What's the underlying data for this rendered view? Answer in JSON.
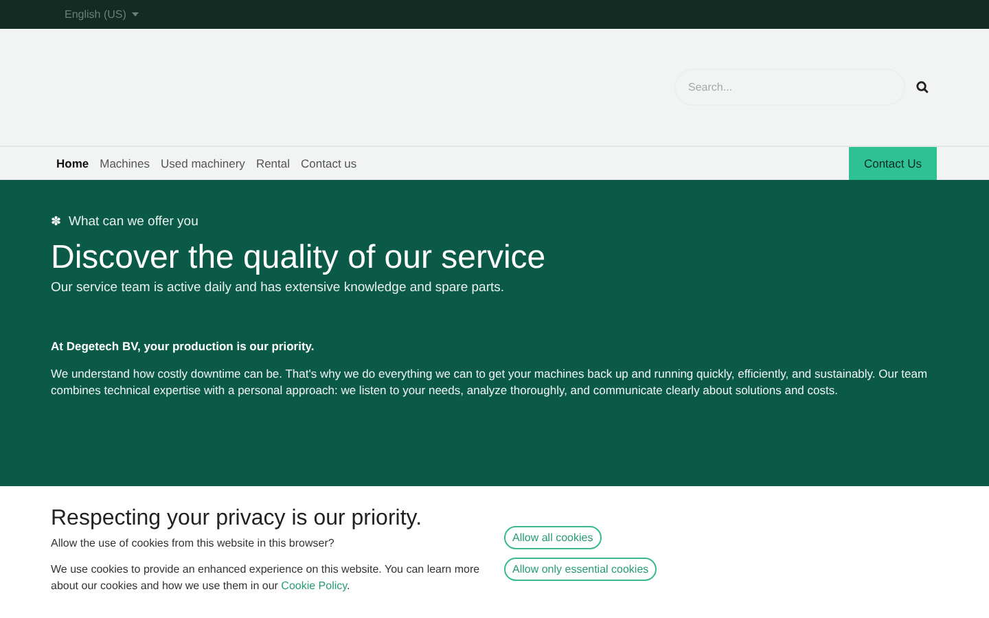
{
  "top_bar": {
    "language": "English (US)"
  },
  "header": {
    "search": {
      "placeholder": "Search..."
    }
  },
  "nav": {
    "items": [
      {
        "label": "Home",
        "selected": true
      },
      {
        "label": "Machines",
        "selected": false
      },
      {
        "label": "Used machinery",
        "selected": false
      },
      {
        "label": "Rental",
        "selected": false
      },
      {
        "label": "Contact us",
        "selected": false
      }
    ],
    "cta": "Contact Us"
  },
  "hero": {
    "eyebrow_icon": "✽",
    "eyebrow": "What can we offer you",
    "title": "Discover the quality of our service",
    "subtitle": "Our service team is active daily and has extensive knowledge and spare parts.",
    "lead": "At Degetech BV, your production is our priority.",
    "body": "We understand how costly downtime can be. That's why we do everything we can to get your machines back up and running quickly, efficiently, and sustainably. Our team combines technical expertise with a personal approach: we listen to your needs, analyze thoroughly, and communicate clearly about solutions and costs."
  },
  "cookie_banner": {
    "title": "Respecting your privacy is our priority.",
    "question": "Allow the use of cookies from this website in this browser?",
    "text": "We use cookies to provide an enhanced experience on this website. You can learn more about our cookies and how we use them in our",
    "link": "Cookie Policy",
    "text_end": ".",
    "buttons": [
      "Allow all cookies",
      "Allow only essential cookies"
    ]
  }
}
